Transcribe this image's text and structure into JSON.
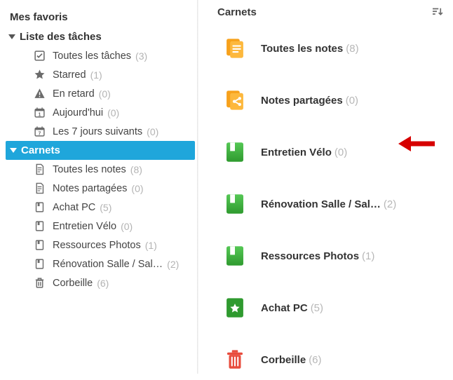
{
  "sidebar": {
    "favorites_label": "Mes favoris",
    "tasks_section_label": "Liste des tâches",
    "tasks": [
      {
        "key": "all",
        "label": "Toutes les tâches",
        "count": "(3)",
        "icon": "check-square-icon"
      },
      {
        "key": "starred",
        "label": "Starred",
        "count": "(1)",
        "icon": "star-icon"
      },
      {
        "key": "overdue",
        "label": "En retard",
        "count": "(0)",
        "icon": "warning-icon"
      },
      {
        "key": "today",
        "label": "Aujourd'hui",
        "count": "(0)",
        "icon": "calendar-1-icon"
      },
      {
        "key": "next7",
        "label": "Les 7 jours suivants",
        "count": "(0)",
        "icon": "calendar-7-icon"
      }
    ],
    "notebooks_section_label": "Carnets",
    "notebooks": [
      {
        "key": "all",
        "label": "Toutes les notes",
        "count": "(8)",
        "icon": "page-icon"
      },
      {
        "key": "shared",
        "label": "Notes partagées",
        "count": "(0)",
        "icon": "page-icon"
      },
      {
        "key": "achat",
        "label": "Achat PC",
        "count": "(5)",
        "icon": "notebook-icon"
      },
      {
        "key": "velo",
        "label": "Entretien Vélo",
        "count": "(0)",
        "icon": "notebook-icon"
      },
      {
        "key": "photos",
        "label": "Ressources Photos",
        "count": "(1)",
        "icon": "notebook-icon"
      },
      {
        "key": "reno",
        "label": "Rénovation Salle / Sal…",
        "count": "(2)",
        "icon": "notebook-icon"
      },
      {
        "key": "trash",
        "label": "Corbeille",
        "count": "(6)",
        "icon": "trash-icon"
      }
    ]
  },
  "right_panel": {
    "title": "Carnets",
    "items": [
      {
        "key": "all",
        "label": "Toutes les notes",
        "count": "(8)",
        "icon": "docs-stack-orange-icon"
      },
      {
        "key": "shared",
        "label": "Notes partagées",
        "count": "(0)",
        "icon": "share-orange-icon"
      },
      {
        "key": "velo",
        "label": "Entretien Vélo",
        "count": "(0)",
        "icon": "notebook-green-icon",
        "highlighted": true
      },
      {
        "key": "reno",
        "label": "Rénovation Salle / Sal…",
        "count": "(2)",
        "icon": "notebook-green-icon"
      },
      {
        "key": "photos",
        "label": "Ressources Photos",
        "count": "(1)",
        "icon": "notebook-green-icon"
      },
      {
        "key": "achat",
        "label": "Achat PC",
        "count": "(5)",
        "icon": "notebook-green-star-icon"
      },
      {
        "key": "trash",
        "label": "Corbeille",
        "count": "(6)",
        "icon": "trash-red-icon"
      }
    ]
  },
  "colors": {
    "selected_bg": "#1fa6db",
    "orange": "#faa61a",
    "green": "#3eb23e",
    "red": "#e84c3d",
    "grey_icon": "#6b6b6b",
    "count_grey": "#b3b3b3"
  }
}
